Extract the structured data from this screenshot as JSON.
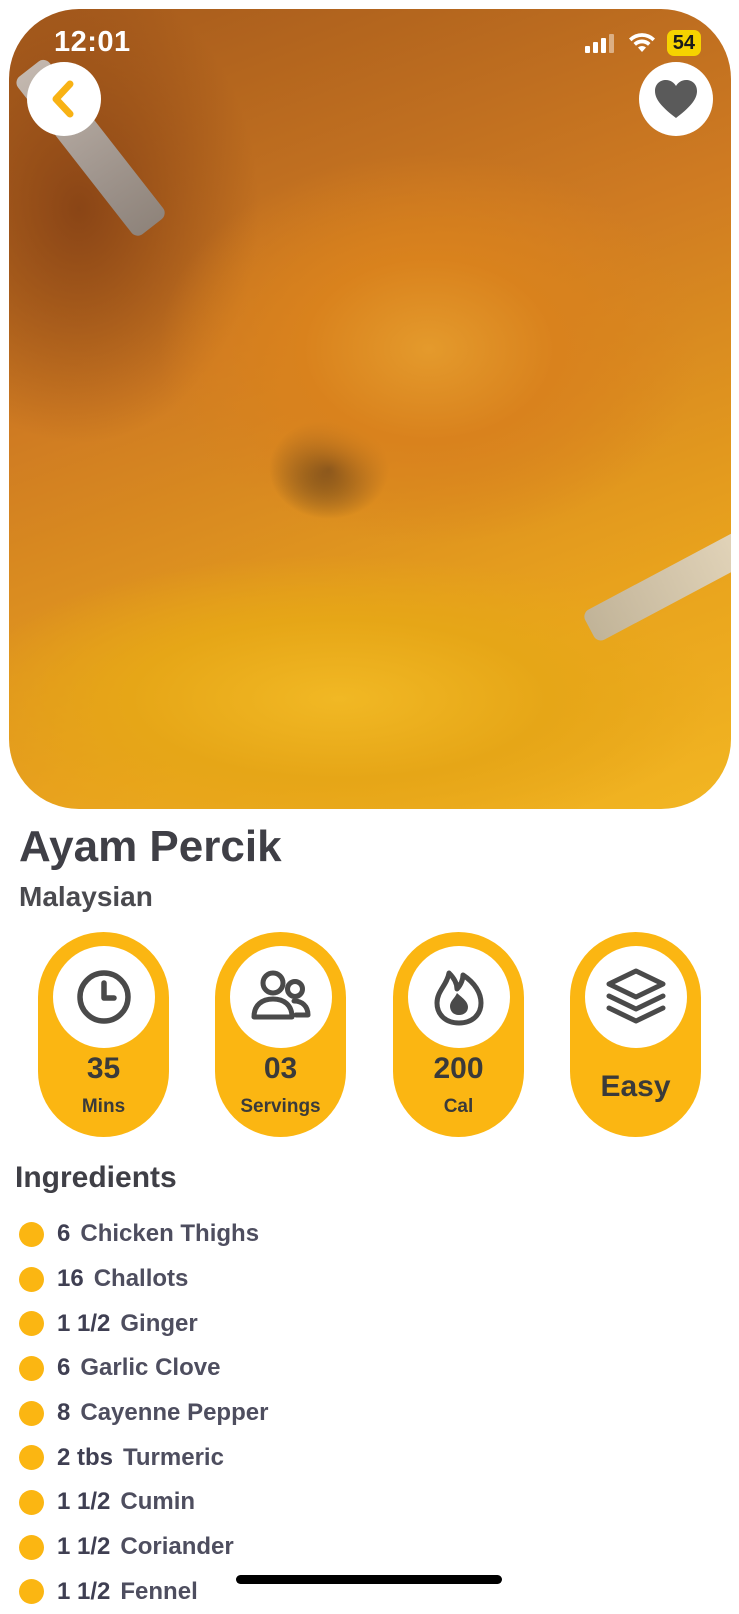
{
  "status_bar": {
    "time": "12:01",
    "battery": "54"
  },
  "recipe": {
    "title": "Ayam Percik",
    "cuisine": "Malaysian"
  },
  "stats": [
    {
      "icon": "clock-icon",
      "value": "35",
      "unit": "Mins"
    },
    {
      "icon": "people-icon",
      "value": "03",
      "unit": "Servings"
    },
    {
      "icon": "flame-icon",
      "value": "200",
      "unit": "Cal"
    },
    {
      "icon": "layers-icon",
      "value": "Easy",
      "unit": ""
    }
  ],
  "ingredients_title": "Ingredients",
  "ingredients": [
    {
      "qty": "6",
      "name": "Chicken Thighs"
    },
    {
      "qty": "16",
      "name": "Challots"
    },
    {
      "qty": "1 1/2",
      "name": "Ginger"
    },
    {
      "qty": "6",
      "name": "Garlic Clove"
    },
    {
      "qty": "8",
      "name": "Cayenne Pepper"
    },
    {
      "qty": "2 tbs",
      "name": "Turmeric"
    },
    {
      "qty": "1 1/2",
      "name": "Cumin"
    },
    {
      "qty": "1 1/2",
      "name": "Coriander"
    },
    {
      "qty": "1 1/2",
      "name": "Fennel"
    }
  ],
  "colors": {
    "accent": "#fbb612",
    "text": "#3f3f46"
  }
}
